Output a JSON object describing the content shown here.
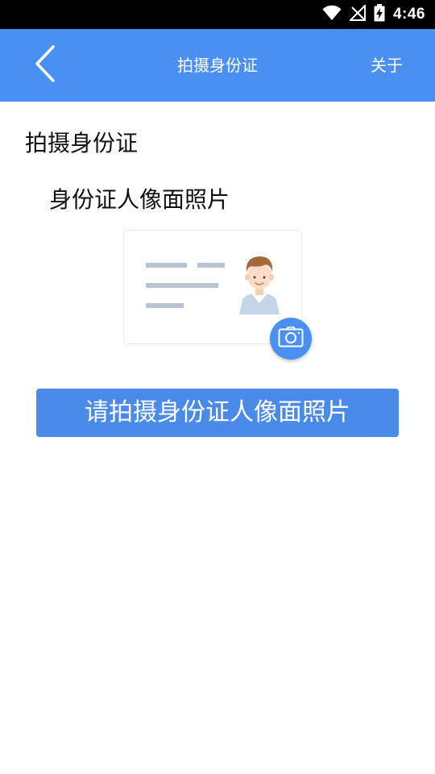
{
  "status_bar": {
    "time": "4:46",
    "icons": [
      "wifi-icon",
      "no-signal-icon",
      "battery-charging-icon"
    ]
  },
  "app_bar": {
    "back_icon": "chevron-left-icon",
    "title": "拍摄身份证",
    "about_label": "关于"
  },
  "main": {
    "section_title": "拍摄身份证",
    "subtitle": "身份证人像面照片",
    "illustration_icon": "id-card-portrait-icon",
    "camera_icon": "camera-icon",
    "capture_button_label": "请拍摄身份证人像面照片"
  },
  "colors": {
    "primary": "#4a90f2",
    "button": "#4a8ae8",
    "status_bar": "#000000",
    "card_lines": "#b8c3d4"
  }
}
